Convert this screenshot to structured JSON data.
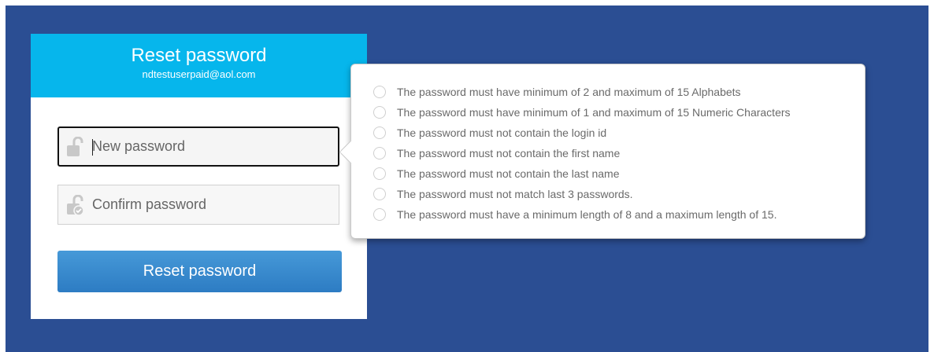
{
  "header": {
    "title": "Reset password",
    "email": "ndtestuserpaid@aol.com"
  },
  "form": {
    "new_password_placeholder": "New password",
    "confirm_password_placeholder": "Confirm password",
    "submit_label": "Reset password"
  },
  "password_rules": [
    "The password must have minimum of 2 and maximum of 15 Alphabets",
    "The password must have minimum of 1 and maximum of 15 Numeric Characters",
    "The password must not contain the login id",
    "The password must not contain the first name",
    "The password must not contain the last name",
    "The password must not match last 3 passwords.",
    "The password must have a minimum length of 8 and a maximum length of 15."
  ],
  "colors": {
    "page_background": "#2b4e93",
    "header_background": "#06b6ec",
    "button_background": "#3a8bd0"
  },
  "icons": {
    "new_password": "lock-open-icon",
    "confirm_password": "lock-check-icon",
    "rule_status": "circle-unchecked-icon"
  }
}
